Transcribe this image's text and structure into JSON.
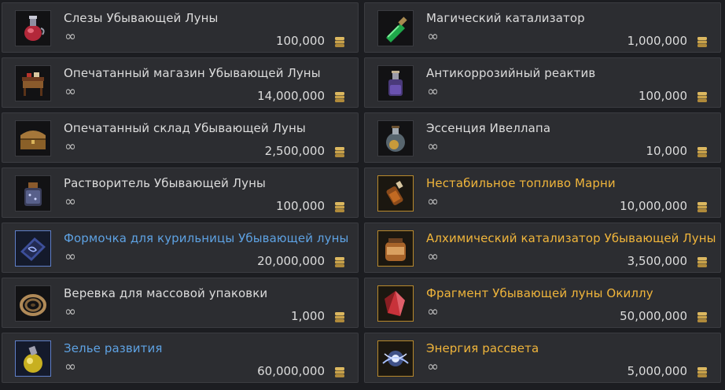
{
  "colors": {
    "background": "#1c1d21",
    "cell": "#2c2d31",
    "name_white": "#dcdcdc",
    "name_blue": "#5ea2e3",
    "name_gold": "#f0b53b",
    "coin": "#c9a24a"
  },
  "items": [
    {
      "name": "Слезы Убывающей Луны",
      "limit": "∞",
      "price": "100,000",
      "grade": "white",
      "icon": "red-potion-flask-icon"
    },
    {
      "name": "Магический катализатор",
      "limit": "∞",
      "price": "1,000,000",
      "grade": "white",
      "icon": "green-potion-bottle-icon"
    },
    {
      "name": "Опечатанный магазин Убывающей Луны",
      "limit": "∞",
      "price": "14,000,000",
      "grade": "white",
      "icon": "shop-stall-icon"
    },
    {
      "name": "Антикоррозийный реактив",
      "limit": "∞",
      "price": "100,000",
      "grade": "white",
      "icon": "purple-reagent-bottle-icon"
    },
    {
      "name": "Опечатанный склад Убывающей Луны",
      "limit": "∞",
      "price": "2,500,000",
      "grade": "white",
      "icon": "wooden-chest-icon"
    },
    {
      "name": "Эссенция Ивеллапа",
      "limit": "∞",
      "price": "10,000",
      "grade": "white",
      "icon": "essence-flask-icon"
    },
    {
      "name": "Растворитель Убывающей Луны",
      "limit": "∞",
      "price": "100,000",
      "grade": "white",
      "icon": "solvent-jar-icon"
    },
    {
      "name": "Нестабильное топливо Марни",
      "limit": "∞",
      "price": "10,000,000",
      "grade": "gold",
      "icon": "fuel-bottle-icon"
    },
    {
      "name": "Формочка для курильницы Убывающей луны",
      "limit": "∞",
      "price": "20,000,000",
      "grade": "blue",
      "icon": "incense-mold-icon"
    },
    {
      "name": "Алхимический катализатор Убывающей Луны",
      "limit": "∞",
      "price": "3,500,000",
      "grade": "gold",
      "icon": "alchemy-jar-icon"
    },
    {
      "name": "Веревка для массовой упаковки",
      "limit": "∞",
      "price": "1,000",
      "grade": "white",
      "icon": "rope-coil-icon"
    },
    {
      "name": "Фрагмент Убывающей луны Окиллу",
      "limit": "∞",
      "price": "50,000,000",
      "grade": "gold",
      "icon": "red-crystal-fragment-icon"
    },
    {
      "name": "Зелье развития",
      "limit": "∞",
      "price": "60,000,000",
      "grade": "blue",
      "icon": "yellow-potion-icon"
    },
    {
      "name": "Энергия рассвета",
      "limit": "∞",
      "price": "5,000,000",
      "grade": "gold",
      "icon": "dawn-energy-icon"
    }
  ]
}
